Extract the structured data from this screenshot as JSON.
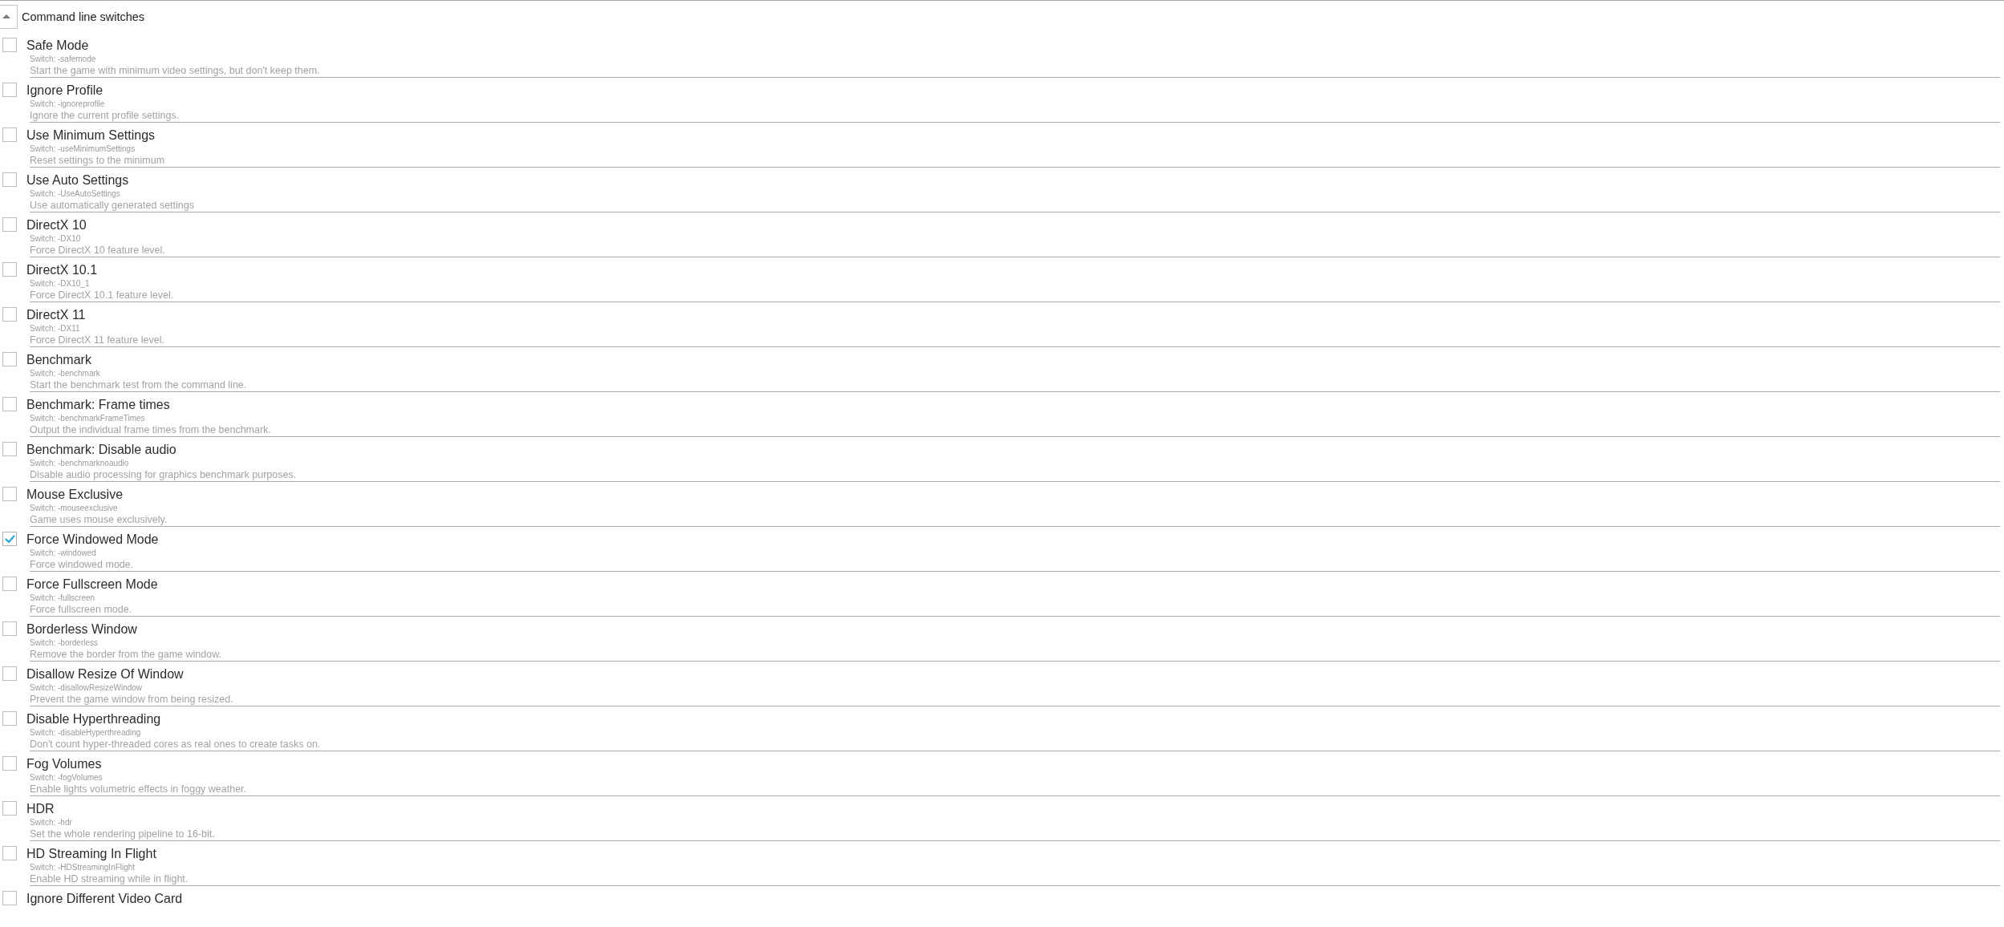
{
  "section": {
    "title": "Command line switches",
    "expanded": true
  },
  "items": [
    {
      "name": "Safe Mode",
      "switch": "Switch: -safemode",
      "description": "Start the game with minimum video settings, but don't keep them.",
      "checked": false
    },
    {
      "name": "Ignore Profile",
      "switch": "Switch: -ignoreprofile",
      "description": "Ignore the current profile settings.",
      "checked": false
    },
    {
      "name": "Use Minimum Settings",
      "switch": "Switch: -useMinimumSettings",
      "description": "Reset settings to the minimum",
      "checked": false
    },
    {
      "name": "Use Auto Settings",
      "switch": "Switch: -UseAutoSettings",
      "description": "Use automatically generated settings",
      "checked": false
    },
    {
      "name": "DirectX 10",
      "switch": "Switch: -DX10",
      "description": "Force DirectX 10 feature level.",
      "checked": false
    },
    {
      "name": "DirectX 10.1",
      "switch": "Switch: -DX10_1",
      "description": "Force DirectX 10.1 feature level.",
      "checked": false
    },
    {
      "name": "DirectX 11",
      "switch": "Switch: -DX11",
      "description": "Force DirectX 11 feature level.",
      "checked": false
    },
    {
      "name": "Benchmark",
      "switch": "Switch: -benchmark",
      "description": "Start the benchmark test from the command line.",
      "checked": false
    },
    {
      "name": "Benchmark: Frame times",
      "switch": "Switch: -benchmarkFrameTimes",
      "description": "Output the individual frame times from the benchmark.",
      "checked": false
    },
    {
      "name": "Benchmark: Disable audio",
      "switch": "Switch: -benchmarknoaudio",
      "description": "Disable audio processing for graphics benchmark purposes.",
      "checked": false
    },
    {
      "name": "Mouse Exclusive",
      "switch": "Switch: -mouseexclusive",
      "description": "Game uses mouse exclusively.",
      "checked": false
    },
    {
      "name": "Force Windowed Mode",
      "switch": "Switch: -windowed",
      "description": "Force windowed mode.",
      "checked": true
    },
    {
      "name": "Force Fullscreen Mode",
      "switch": "Switch: -fullscreen",
      "description": "Force fullscreen mode.",
      "checked": false
    },
    {
      "name": "Borderless Window",
      "switch": "Switch: -borderless",
      "description": "Remove the border from the game window.",
      "checked": false
    },
    {
      "name": "Disallow Resize Of Window",
      "switch": "Switch: -disallowResizeWindow",
      "description": "Prevent the game window from being resized.",
      "checked": false
    },
    {
      "name": "Disable Hyperthreading",
      "switch": "Switch: -disableHyperthreading",
      "description": "Don't count hyper-threaded cores as real ones to create tasks on.",
      "checked": false
    },
    {
      "name": "Fog Volumes",
      "switch": "Switch: -fogVolumes",
      "description": "Enable lights volumetric effects in foggy weather.",
      "checked": false
    },
    {
      "name": "HDR",
      "switch": "Switch: -hdr",
      "description": "Set the whole rendering pipeline to 16-bit.",
      "checked": false
    },
    {
      "name": "HD Streaming In Flight",
      "switch": "Switch: -HDStreamingInFlight",
      "description": "Enable HD streaming while in flight.",
      "checked": false
    },
    {
      "name": "Ignore Different Video Card",
      "checked": false
    }
  ]
}
